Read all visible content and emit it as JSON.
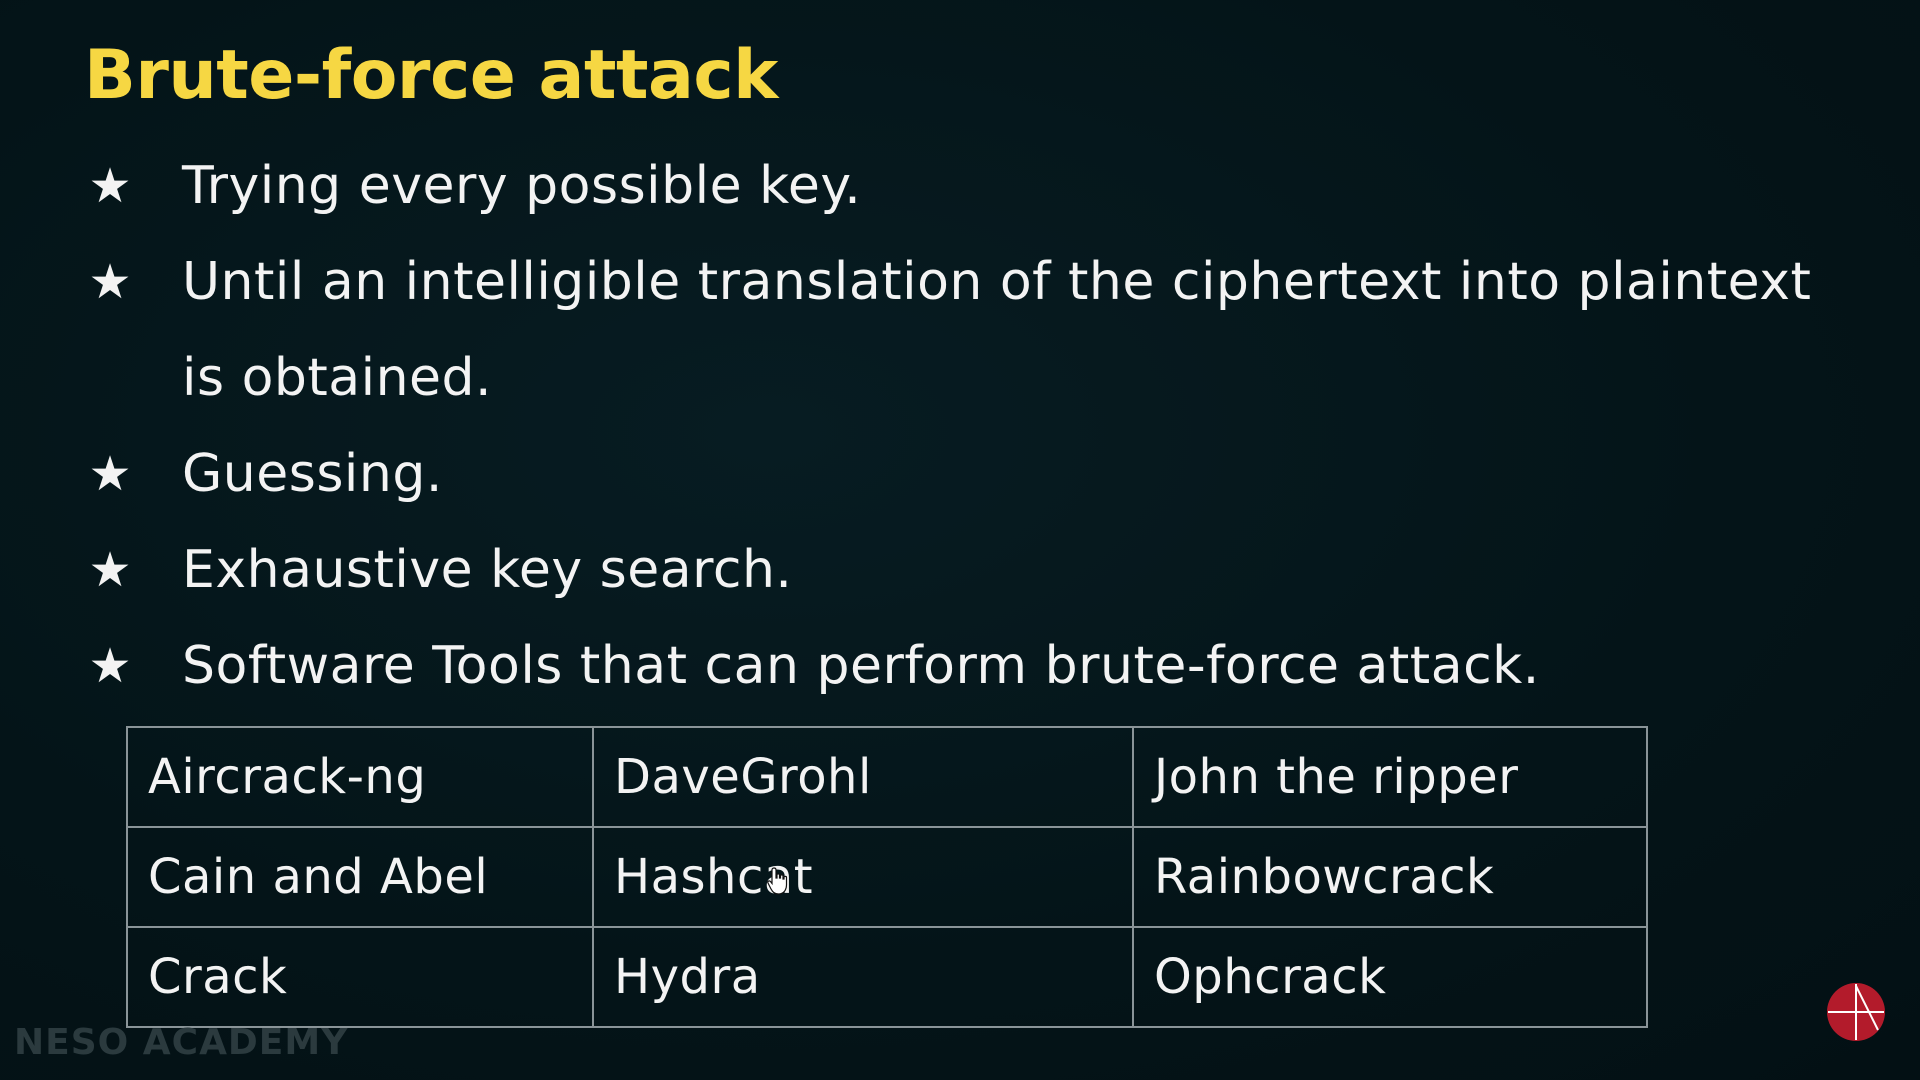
{
  "slide": {
    "title": "Brute-force attack",
    "bullets": [
      {
        "icon": "star-icon",
        "line1": "Trying every possible key."
      },
      {
        "icon": "star-icon",
        "line1": "Until an intelligible translation of the ciphertext into plaintext",
        "line2": "is obtained."
      },
      {
        "icon": "star-icon",
        "line1": "Guessing."
      },
      {
        "icon": "star-icon",
        "line1": "Exhaustive key search."
      },
      {
        "icon": "star-icon",
        "line1": "Software Tools that can perform brute-force attack."
      }
    ],
    "tools_table": {
      "rows": [
        [
          "Aircrack-ng",
          "DaveGrohl",
          "John the ripper"
        ],
        [
          "Cain and Abel",
          "Hashcat",
          "Rainbowcrack"
        ],
        [
          "Crack",
          "Hydra",
          "Ophcrack"
        ]
      ]
    },
    "watermark": "NESO ACADEMY",
    "colors": {
      "background": "#04141a",
      "title": "#f6d743",
      "text": "#f3f3f3",
      "table_border": "#8a9498",
      "logo": "#b31b2b"
    }
  }
}
